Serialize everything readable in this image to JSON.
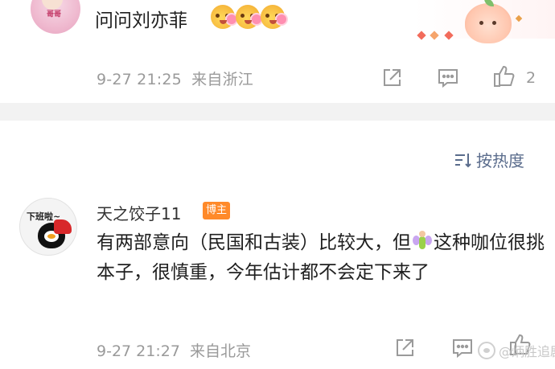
{
  "top_comment": {
    "avatar_sticker": "哥哥",
    "text": "问问刘亦菲",
    "emoji_count": 3,
    "emoji_name": "flower-face-emoji",
    "time": "9-27 21:25",
    "location": "来自浙江",
    "like_count": "2"
  },
  "sort": {
    "label": "按热度"
  },
  "comment": {
    "avatar_caption": "下班啦~",
    "username": "天之饺子11",
    "badge": "博主",
    "text_before_emoji": "有两部意向（民国和古装）比较大，但",
    "emoji_name": "fairy-emoji",
    "text_after_emoji": "这种咖位很挑本子，很慎重，今年估计都不会定下来了",
    "time": "9-27 21:27",
    "location": "来自北京"
  },
  "watermark": {
    "text": "@炳胜追剧"
  },
  "colors": {
    "meta": "#9a9a9a",
    "sort": "#5a6c8c",
    "badge": "#ff8a2a",
    "divider": "#f2f2f2",
    "icon": "#9a9a9a"
  },
  "icons": {
    "share": "share-icon",
    "comment": "comment-icon",
    "like": "thumbs-up-icon",
    "sort": "sort-icon"
  }
}
